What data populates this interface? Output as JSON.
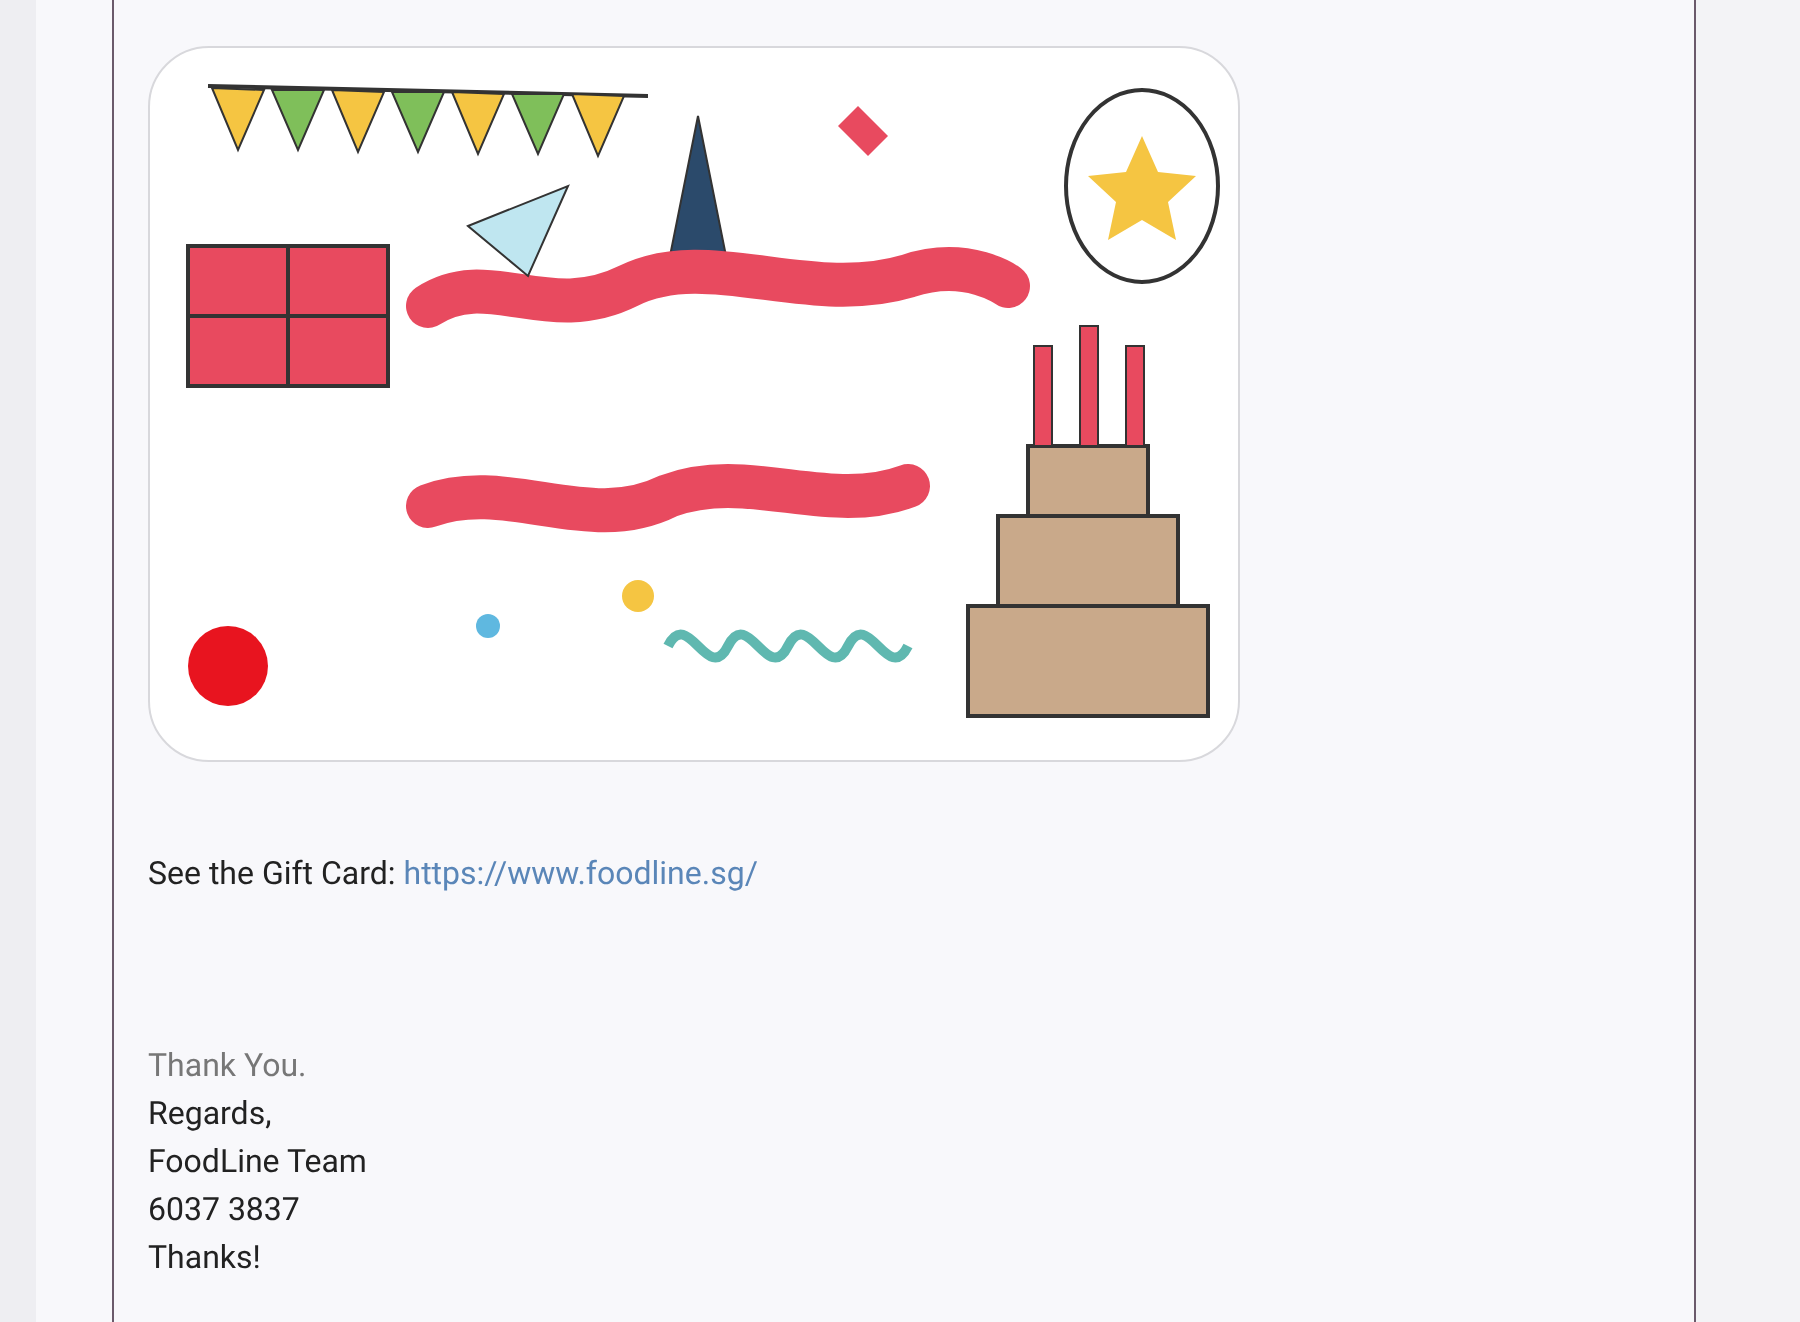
{
  "email": {
    "gift_card_label": "See the Gift Card:",
    "gift_card_link": "https://www.foodline.sg/",
    "closing": "Thank You.",
    "signature": [
      "Regards,",
      "FoodLine Team",
      "6037 3837",
      "Thanks!"
    ]
  }
}
